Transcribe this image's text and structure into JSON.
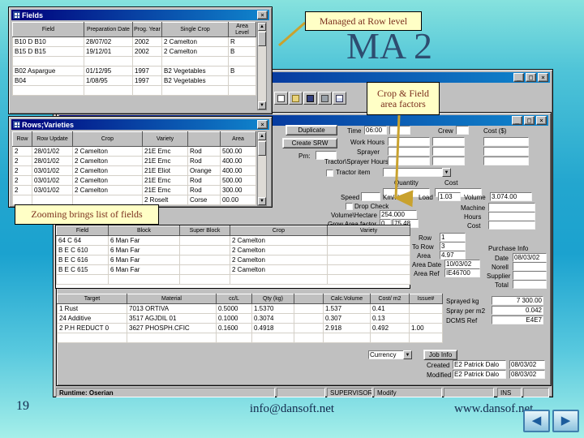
{
  "chrome": {
    "minimize": "_",
    "maximize": "□",
    "close": "×",
    "scroll_up": "▲",
    "scroll_down": "▼",
    "dropdown": "▼",
    "nav_back": "◀",
    "nav_forward": "▶"
  },
  "slide": {
    "page_number": "19",
    "email": "info@dansoft.net",
    "website": "www.dansof.net",
    "headline": "MA 2"
  },
  "callouts": {
    "row_level": "Managed at Row level",
    "area_factors": "Crop & Field area factors",
    "zooming": "Zooming brings list of fields"
  },
  "fields_window": {
    "title": "Fields",
    "columns": [
      "Field",
      "Preparation Date",
      "Prog. Year",
      "Single Crop",
      "Area Level"
    ],
    "rows": [
      [
        "B10  D B10",
        "28/07/02",
        "2002",
        "2 Camelton",
        "R"
      ],
      [
        "B15  D B15",
        "19/12/01",
        "2002",
        "2 Camelton",
        "B"
      ],
      [
        "",
        "",
        "",
        "",
        ""
      ],
      [
        "B02  Aspargue",
        "01/12/95",
        "1997",
        "B2 Vegetables",
        "B"
      ],
      [
        "B04",
        "1/08/95",
        "1997",
        "B2 Vegetables",
        ""
      ],
      [
        "",
        "",
        "",
        "",
        ""
      ]
    ]
  },
  "rows_window": {
    "title": "Rows;Varieties",
    "columns": [
      "Row",
      "Row Update",
      "Crop",
      "Variety",
      "",
      "Area"
    ],
    "rows": [
      [
        "2",
        "28/01/02",
        "2 Camelton",
        "21E Emc",
        "Rod",
        "500.00"
      ],
      [
        "2",
        "28/01/02",
        "2 Camelton",
        "21E Emc",
        "Rod",
        "400.00"
      ],
      [
        "2",
        "03/01/02",
        "2 Camelton",
        "21E Eliot",
        "Orange",
        "400.00"
      ],
      [
        "2",
        "03/01/02",
        "2 Camelton",
        "21E Emc",
        "Rod",
        "500.00"
      ],
      [
        "2",
        "03/01/02",
        "2 Camelton",
        "21E Emc",
        "Rod",
        "300.00"
      ],
      [
        "",
        "",
        "",
        "2 Roselt",
        "Corse",
        "00.00"
      ]
    ]
  },
  "fields_popup": {
    "columns": [
      "Field",
      "Block",
      "Super Block",
      "Crop",
      "Variety"
    ],
    "rows": [
      [
        "64 C 64",
        "6 Man Far",
        "",
        "2 Camelton",
        ""
      ],
      [
        "B E C 610",
        "6 Man Far",
        "",
        "2 Camelton",
        ""
      ],
      [
        "B E C 616",
        "6 Man Far",
        "",
        "2 Camelton",
        ""
      ],
      [
        "B E C 615",
        "6 Man Far",
        "",
        "2 Camelton",
        ""
      ],
      [
        "",
        "",
        "",
        "",
        ""
      ]
    ]
  },
  "materials_table": {
    "columns": [
      "Target",
      "Material",
      "cc/L",
      "Qty (kg)",
      "",
      "Calc.Volume",
      "Cost/ m2",
      "Issue#"
    ],
    "rows": [
      [
        "1 Rust",
        "7013 ORTIVA",
        "0.5000",
        "1.5370",
        "",
        "1.537",
        "0.41",
        ""
      ],
      [
        "24 Additive",
        "3517 AGJDIL 01",
        "0.1000",
        "0.3074",
        "",
        "0.307",
        "0.13",
        ""
      ],
      [
        "2 P.H REDUCT 0",
        "3627 PHOSPH.CFIC",
        "0.1600",
        "0.4918",
        "",
        "2.918",
        "0.492",
        "1.00"
      ],
      [
        "",
        "",
        "",
        "",
        "",
        "",
        "",
        ""
      ]
    ]
  },
  "main_window": {
    "title": "",
    "child_title": "",
    "buttons": {
      "duplicate": "Duplicate",
      "create_srw": "Create SRW",
      "prn": "Prn:"
    },
    "labels": {
      "time": "Time",
      "crew": "Crew",
      "cost_hdr": "Cost ($)",
      "work_hours": "Work Hours",
      "sprayer": "Sprayer",
      "tractor_hours": "Tractor\\Sprayer Hours",
      "tractor_item": "Tractor item",
      "quantity": "Quantity",
      "cost": "Cost",
      "speed": "Speed",
      "km_hour": "Km/Hour",
      "load": "Load",
      "volume": "Volume",
      "drop_check": "Drop Check",
      "volume_hectare": "Volume\\Hectare",
      "grow_area": "Grow Area factor",
      "machine": "Machine",
      "hours": "Hours",
      "cost2": "Cost",
      "purchase_info": "Purchase Info",
      "date": "Date",
      "norell": "Norell",
      "supplier": "Supplier",
      "total": "Total",
      "row": "Row",
      "to_row": "To Row",
      "area": "Area",
      "area_date": "Area Date",
      "area_ref": "Area Ref",
      "currency": "Currency",
      "job_info": "Job Info",
      "created": "Created",
      "modified": "Modified",
      "sprayed": "Sprayed kg",
      "spray_per_m2": "Spray per m2",
      "dcms_ref": "DCMS Ref"
    },
    "values": {
      "time_from": "06:00",
      "load": "1.03",
      "volume": "3.074.00",
      "volume_hectare": "254.000",
      "grow_area_a": "0",
      "grow_area_b": "75.48",
      "row": "1",
      "to_row": "3",
      "area": "4.97",
      "area_date": "10/03/02",
      "area_ref": "IE46700",
      "purchase_date": "08/03/02",
      "sprayed": "7 300.00",
      "spray_per_m2": "0.042",
      "dcms_ref": "E4E7",
      "created_by": "E2 Patrick Dalo",
      "created_date": "08/03/02",
      "modified_by": "E2 Patrick Dalo",
      "modified_date": "08/03/02"
    },
    "statusbar": {
      "runtime": "Runtime: Oserian",
      "user": "SUPERVISOR",
      "mode": "Modify",
      "ins": "INS"
    }
  }
}
